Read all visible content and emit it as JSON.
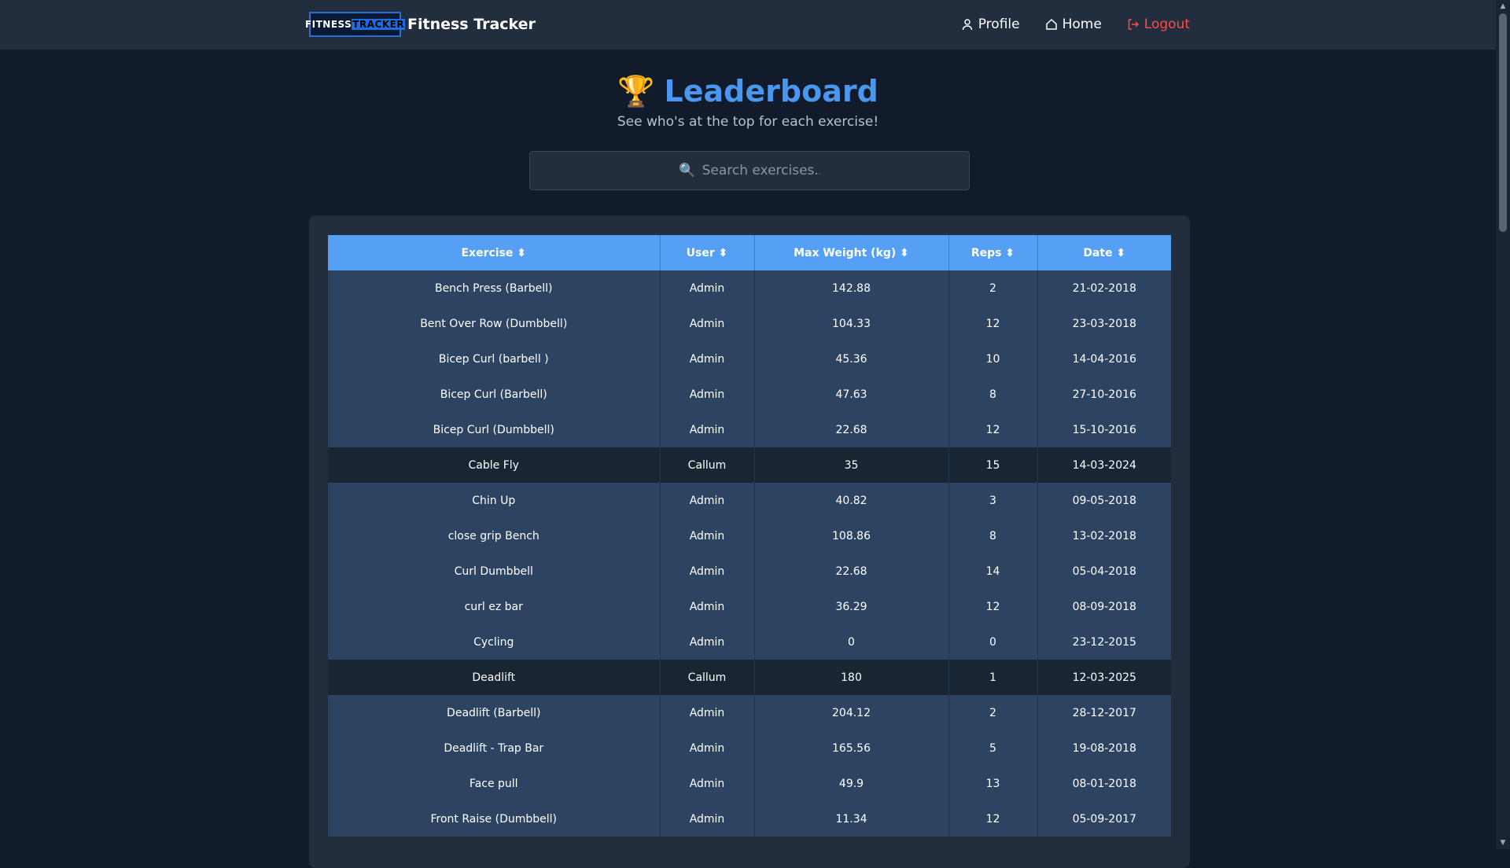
{
  "nav": {
    "logo_part1": "FITNESS",
    "logo_part2": "TRACKER",
    "title": "Fitness Tracker",
    "profile": "Profile",
    "home": "Home",
    "logout": "Logout"
  },
  "hero": {
    "title": "Leaderboard",
    "subtitle": "See who's at the top for each exercise!"
  },
  "search": {
    "placeholder": "Search exercises..."
  },
  "table": {
    "headers": [
      "Exercise ⬍",
      "User ⬍",
      "Max Weight (kg) ⬍",
      "Reps ⬍",
      "Date ⬍"
    ],
    "rows": [
      [
        "Bench Press (Barbell)",
        "Admin",
        "142.88",
        "2",
        "21-02-2018"
      ],
      [
        "Bent Over Row (Dumbbell)",
        "Admin",
        "104.33",
        "12",
        "23-03-2018"
      ],
      [
        "Bicep Curl (barbell )",
        "Admin",
        "45.36",
        "10",
        "14-04-2016"
      ],
      [
        "Bicep Curl (Barbell)",
        "Admin",
        "47.63",
        "8",
        "27-10-2016"
      ],
      [
        "Bicep Curl (Dumbbell)",
        "Admin",
        "22.68",
        "12",
        "15-10-2016"
      ],
      [
        "Cable Fly",
        "Callum",
        "35",
        "15",
        "14-03-2024"
      ],
      [
        "Chin Up",
        "Admin",
        "40.82",
        "3",
        "09-05-2018"
      ],
      [
        "close grip Bench",
        "Admin",
        "108.86",
        "8",
        "13-02-2018"
      ],
      [
        "Curl Dumbbell",
        "Admin",
        "22.68",
        "14",
        "05-04-2018"
      ],
      [
        "curl ez bar",
        "Admin",
        "36.29",
        "12",
        "08-09-2018"
      ],
      [
        "Cycling",
        "Admin",
        "0",
        "0",
        "23-12-2015"
      ],
      [
        "Deadlift",
        "Callum",
        "180",
        "1",
        "12-03-2025"
      ],
      [
        "Deadlift (Barbell)",
        "Admin",
        "204.12",
        "2",
        "28-12-2017"
      ],
      [
        "Deadlift - Trap Bar",
        "Admin",
        "165.56",
        "5",
        "19-08-2018"
      ],
      [
        "Face pull",
        "Admin",
        "49.9",
        "13",
        "08-01-2018"
      ],
      [
        "Front Raise (Dumbbell)",
        "Admin",
        "11.34",
        "12",
        "05-09-2017"
      ]
    ]
  }
}
